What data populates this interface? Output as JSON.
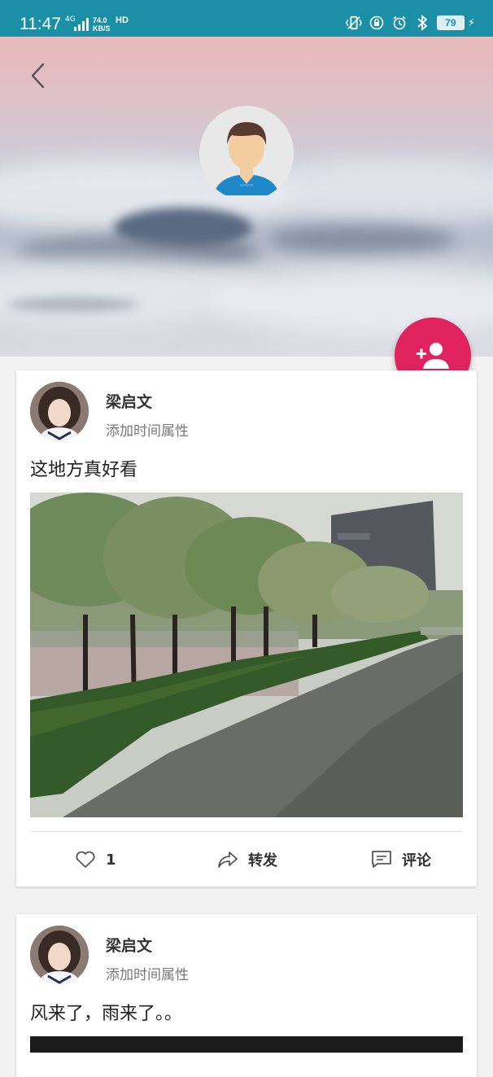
{
  "status_bar": {
    "time": "11:47",
    "network": "4G",
    "speed_value": "74.0",
    "speed_unit": "KB/S",
    "hd": "HD",
    "battery": "79"
  },
  "header": {
    "back_icon": "chevron-left-icon",
    "avatar_icon": "default-user-avatar",
    "fab_icon": "add-person-icon",
    "fab_color": "#e0225f"
  },
  "posts": [
    {
      "author": "梁启文",
      "subtitle": "添加时间属性",
      "text": "这地方真好看",
      "likes": "1",
      "share_label": "转发",
      "comment_label": "评论"
    },
    {
      "author": "梁启文",
      "subtitle": "添加时间属性",
      "text": "风来了，雨来了。。"
    }
  ],
  "colors": {
    "status_bar": "#1a8fa6",
    "accent": "#e0225f"
  }
}
